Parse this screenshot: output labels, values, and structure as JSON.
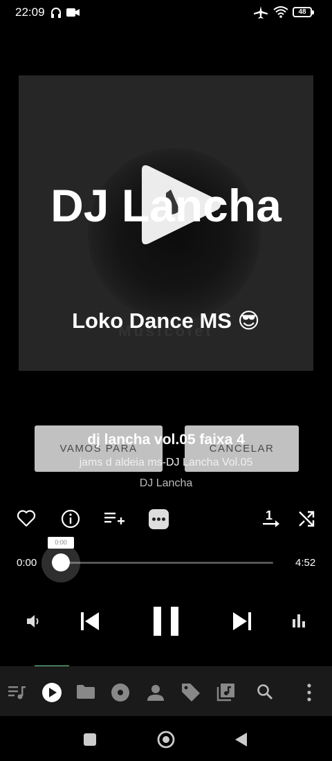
{
  "status_bar": {
    "time": "22:09",
    "battery": "48",
    "icons": [
      "headphones-icon",
      "video-camera-icon",
      "airplane-icon",
      "wifi-icon",
      "battery-icon"
    ]
  },
  "album_art": {
    "artist_text": "DJ Lancha",
    "subtitle_text": "Loko Dance MS 😎",
    "watermark_text": "Musicolet"
  },
  "dialog": {
    "go_to_label": "VAMOS PARA",
    "cancel_label": "CANCELAR"
  },
  "track": {
    "title": "dj lancha vol.05 faixa 4",
    "album": "jams d aldeia ms-DJ Lancha Vol.05",
    "artist": "DJ Lancha"
  },
  "actions": {
    "icons": [
      "heart-icon",
      "info-icon",
      "add-to-queue-icon",
      "more-options-icon",
      "repeat-one-icon",
      "shuffle-icon"
    ]
  },
  "seekbar": {
    "current": "0:00",
    "total": "4:52",
    "tooltip": "0:00",
    "progress": 0
  },
  "controls": {
    "icons": [
      "volume-icon",
      "previous-icon",
      "pause-icon",
      "next-icon",
      "equalizer-icon"
    ]
  },
  "bottom_nav": {
    "active_index": 1,
    "accent_color": "#7ee0a0",
    "items": [
      "queue-icon",
      "now-playing-icon",
      "folders-icon",
      "albums-icon",
      "artists-icon",
      "tags-icon",
      "playlists-icon",
      "search-icon",
      "menu-icon"
    ]
  },
  "system_nav": [
    "recents-button",
    "home-button",
    "back-button"
  ]
}
